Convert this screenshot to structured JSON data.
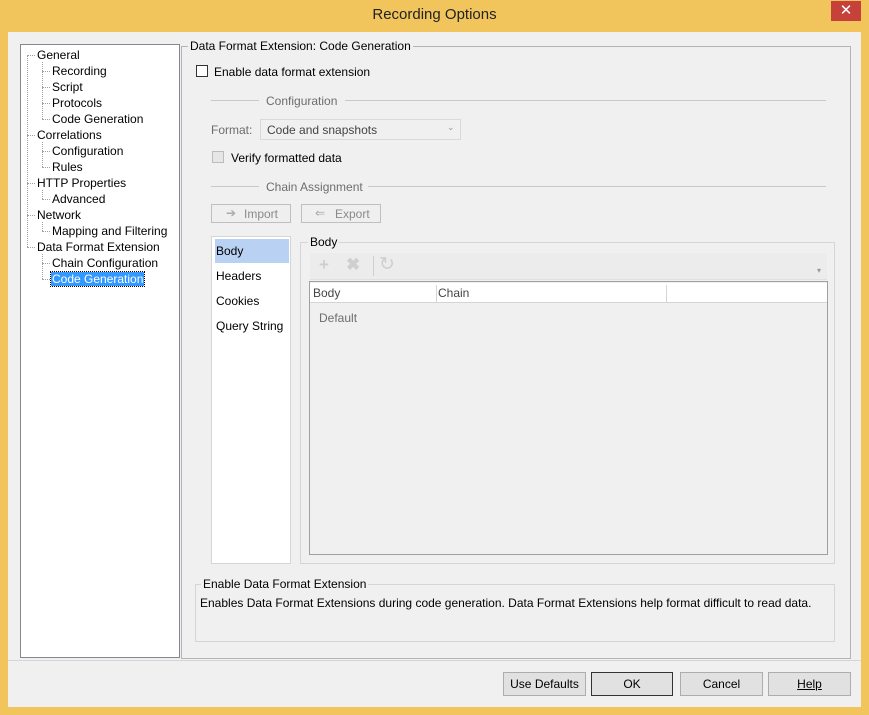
{
  "window": {
    "title": "Recording Options",
    "close_glyph": "✕"
  },
  "tree": {
    "nodes": [
      {
        "label": "General",
        "level": 0
      },
      {
        "label": "Recording",
        "level": 1
      },
      {
        "label": "Script",
        "level": 1
      },
      {
        "label": "Protocols",
        "level": 1
      },
      {
        "label": "Code Generation",
        "level": 1
      },
      {
        "label": "Correlations",
        "level": 0
      },
      {
        "label": "Configuration",
        "level": 1
      },
      {
        "label": "Rules",
        "level": 1
      },
      {
        "label": "HTTP Properties",
        "level": 0
      },
      {
        "label": "Advanced",
        "level": 1
      },
      {
        "label": "Network",
        "level": 0
      },
      {
        "label": "Mapping and Filtering",
        "level": 1
      },
      {
        "label": "Data Format Extension",
        "level": 0
      },
      {
        "label": "Chain Configuration",
        "level": 1
      },
      {
        "label": "Code Generation",
        "level": 1,
        "selected": true
      }
    ]
  },
  "panel": {
    "group_title": "Data Format Extension: Code Generation",
    "enable_label": "Enable data format extension",
    "configuration_title": "Configuration",
    "format_label": "Format:",
    "format_value": "Code and snapshots",
    "verify_label": "Verify formatted data",
    "chain_title": "Chain Assignment",
    "import_label": "Import",
    "export_label": "Export",
    "categories": [
      "Body",
      "Headers",
      "Cookies",
      "Query String"
    ],
    "active_category": "Body",
    "body_title": "Body",
    "grid": {
      "columns": [
        "Body",
        "Chain",
        ""
      ],
      "rows": [
        [
          "Default",
          "",
          ""
        ]
      ]
    }
  },
  "description": {
    "title": "Enable Data Format Extension",
    "text": "Enables Data Format Extensions during code generation. Data Format Extensions help format difficult to read data."
  },
  "footer": {
    "use_defaults": "Use Defaults",
    "ok": "OK",
    "cancel": "Cancel",
    "help": "Help"
  },
  "colors": {
    "frame": "#f2c55c",
    "selection": "#3399ff",
    "active_category": "#b9d1f2",
    "close": "#c6413a"
  }
}
